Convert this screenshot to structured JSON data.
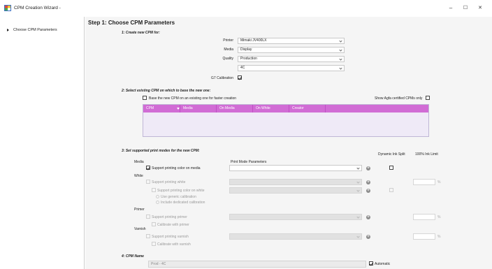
{
  "window": {
    "title": "CPM Creation Wizard -",
    "controls": {
      "minimize": "–",
      "maximize": "☐",
      "close": "✕"
    }
  },
  "sidebar": {
    "items": [
      {
        "label": "Choose CPM Parameters",
        "active": true
      }
    ]
  },
  "step": {
    "title": "Step 1: Choose CPM Parameters"
  },
  "section1": {
    "title": "1: Create new CPM for:",
    "printer_label": "Printer",
    "printer_value": "Mimaki JV400LX",
    "media_label": "Media",
    "media_value": "Display",
    "quality_label": "Quality",
    "quality_value": "Production",
    "colorset_value": "4C",
    "g7_label": "G7 Calibration",
    "g7_checked": true
  },
  "section2": {
    "title": "2: Select existing CPM on which to base the new one:",
    "base_label": "Base the new CPM on an existing one for faster creation",
    "show_agfa_label": "Show Agfa certified CPMs only",
    "columns": [
      "CPM",
      "Media",
      "On Media",
      "On White",
      "Creator"
    ]
  },
  "section3": {
    "title": "3: Set supported print modes for the new CPM:",
    "col_dynamic": "Dynamic Ink Split",
    "col_ink_limit": "100% Ink Limit",
    "col_print_mode": "Print Mode Parameters",
    "media_group": "Media",
    "support_color_media": "Support printing color on media",
    "white_group": "White",
    "support_white": "Support printing white",
    "support_color_white": "Support printing color on white",
    "use_generic": "Use generic calibration",
    "include_dedicated": "Include dedicated calibration",
    "primer_group": "Primer",
    "support_primer": "Support printing primer",
    "calibrate_primer": "Calibrate with primer",
    "varnish_group": "Varnish",
    "support_varnish": "Support printing varnish",
    "calibrate_varnish": "Calibrate with varnish",
    "percent": "%"
  },
  "section4": {
    "title": "4: CPM Name",
    "name_value": "Prod - 4C",
    "automatic_label": "Automatic",
    "automatic_checked": true
  },
  "colors": {
    "accent_header": "#d16cd5",
    "background": "#f5f5f5"
  },
  "icons": [
    "app-icon",
    "sidebar-arrow-icon",
    "chevron-down-icon",
    "filter-icon",
    "add-icon",
    "checkmark-icon"
  ]
}
